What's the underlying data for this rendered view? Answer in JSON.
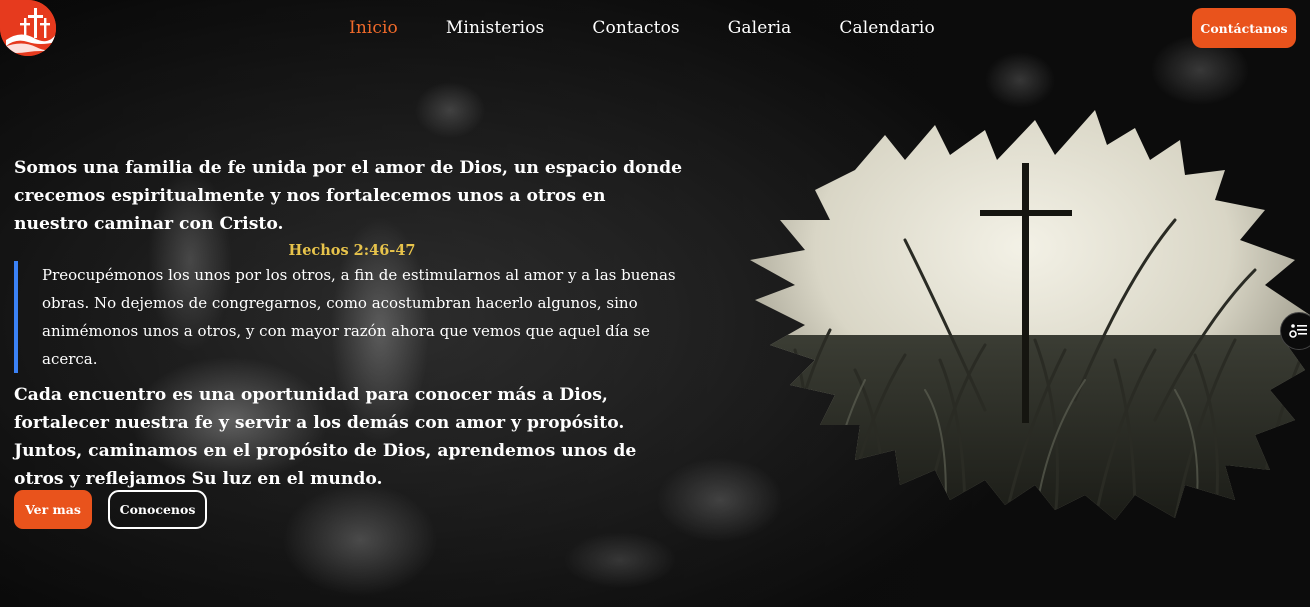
{
  "nav": {
    "items": [
      {
        "label": "Inicio",
        "active": true
      },
      {
        "label": "Ministerios",
        "active": false
      },
      {
        "label": "Contactos",
        "active": false
      },
      {
        "label": "Galeria",
        "active": false
      },
      {
        "label": "Calendario",
        "active": false
      }
    ],
    "cta_label": "Contáctanos"
  },
  "hero": {
    "intro": "Somos una familia de fe unida por el amor de Dios, un espacio donde crecemos espiritualmente y nos fortalecemos unos a otros en nuestro caminar con Cristo.",
    "verse_ref": "Hechos 2:46-47",
    "verse_text": "Preocupémonos los unos por los otros, a fin de estimularnos al amor y a las buenas obras. No dejemos de congregarnos, como acostumbran hacerlo algunos, sino animémonos unos a otros, y con mayor razón ahora que vemos que aquel día se acerca.",
    "closing": "Cada encuentro es una oportunidad para conocer más a Dios, fortalecer nuestra fe y servir a los demás con amor y propósito. Juntos, caminamos en el propósito de Dios, aprendemos unos de otros y reflejamos Su luz en el mundo.",
    "primary_button": "Ver mas",
    "secondary_button": "Conocenos"
  },
  "colors": {
    "accent": "#e9531c",
    "active_nav": "#f06a2a",
    "verse_ref": "#e7c34b",
    "quote_border": "#3b82f6",
    "logo_bg": "#e63a1e"
  },
  "icons": {
    "logo": "church-crosses-logo",
    "side_widget": "accessibility-settings-icon"
  }
}
